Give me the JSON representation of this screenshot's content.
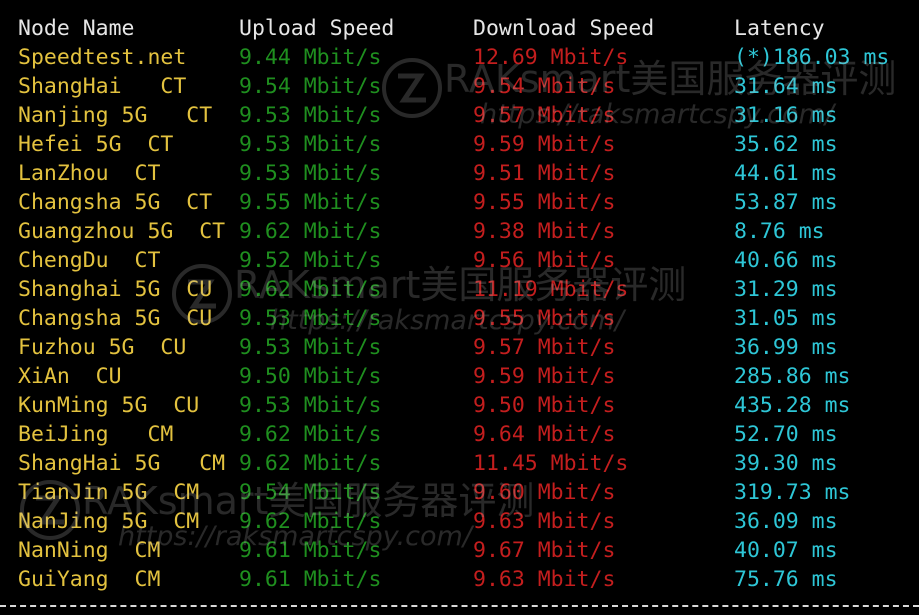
{
  "header": {
    "node_name": "Node Name",
    "upload_speed": "Upload Speed",
    "download_speed": "Download Speed",
    "latency": "Latency"
  },
  "rows": [
    {
      "node": "Speedtest.net",
      "upload": "9.44 Mbit/s",
      "download": "12.69 Mbit/s",
      "latency": "(*)186.03 ms"
    },
    {
      "node": "ShangHai   CT",
      "upload": "9.54 Mbit/s",
      "download": "9.54 Mbit/s",
      "latency": "31.64 ms"
    },
    {
      "node": "Nanjing 5G   CT",
      "upload": "9.53 Mbit/s",
      "download": "9.57 Mbit/s",
      "latency": "31.16 ms"
    },
    {
      "node": "Hefei 5G  CT",
      "upload": "9.53 Mbit/s",
      "download": "9.59 Mbit/s",
      "latency": "35.62 ms"
    },
    {
      "node": "LanZhou  CT",
      "upload": "9.53 Mbit/s",
      "download": "9.51 Mbit/s",
      "latency": "44.61 ms"
    },
    {
      "node": "Changsha 5G  CT",
      "upload": "9.55 Mbit/s",
      "download": "9.55 Mbit/s",
      "latency": "53.87 ms"
    },
    {
      "node": "Guangzhou 5G  CT",
      "upload": "9.62 Mbit/s",
      "download": "9.38 Mbit/s",
      "latency": "8.76 ms"
    },
    {
      "node": "ChengDu  CT",
      "upload": "9.52 Mbit/s",
      "download": "9.56 Mbit/s",
      "latency": "40.66 ms"
    },
    {
      "node": "Shanghai 5G  CU",
      "upload": "9.62 Mbit/s",
      "download": "11.19 Mbit/s",
      "latency": "31.29 ms"
    },
    {
      "node": "Changsha 5G  CU",
      "upload": "9.53 Mbit/s",
      "download": "9.55 Mbit/s",
      "latency": "31.05 ms"
    },
    {
      "node": "Fuzhou 5G  CU",
      "upload": "9.53 Mbit/s",
      "download": "9.57 Mbit/s",
      "latency": "36.99 ms"
    },
    {
      "node": "XiAn  CU",
      "upload": "9.50 Mbit/s",
      "download": "9.59 Mbit/s",
      "latency": "285.86 ms"
    },
    {
      "node": "KunMing 5G  CU",
      "upload": "9.53 Mbit/s",
      "download": "9.50 Mbit/s",
      "latency": "435.28 ms"
    },
    {
      "node": "BeiJing   CM",
      "upload": "9.62 Mbit/s",
      "download": "9.64 Mbit/s",
      "latency": "52.70 ms"
    },
    {
      "node": "ShangHai 5G   CM",
      "upload": "9.62 Mbit/s",
      "download": "11.45 Mbit/s",
      "latency": "39.30 ms"
    },
    {
      "node": "TianJin 5G  CM",
      "upload": "9.54 Mbit/s",
      "download": "9.60 Mbit/s",
      "latency": "319.73 ms"
    },
    {
      "node": "NanJing 5G  CM",
      "upload": "9.62 Mbit/s",
      "download": "9.63 Mbit/s",
      "latency": "36.09 ms"
    },
    {
      "node": "NanNing  CM",
      "upload": "9.61 Mbit/s",
      "download": "9.67 Mbit/s",
      "latency": "40.07 ms"
    },
    {
      "node": "GuiYang  CM",
      "upload": "9.61 Mbit/s",
      "download": "9.63 Mbit/s",
      "latency": "75.76 ms"
    }
  ],
  "watermark": {
    "brand": "RAKsmart美国服务器评测",
    "url": "https://raksmartcspy.com/"
  },
  "colors": {
    "node": "#e3c23f",
    "upload": "#1f8f1f",
    "download": "#c41e1e",
    "latency": "#2ec6d6",
    "header": "#e6e6e6",
    "background": "#000000"
  }
}
